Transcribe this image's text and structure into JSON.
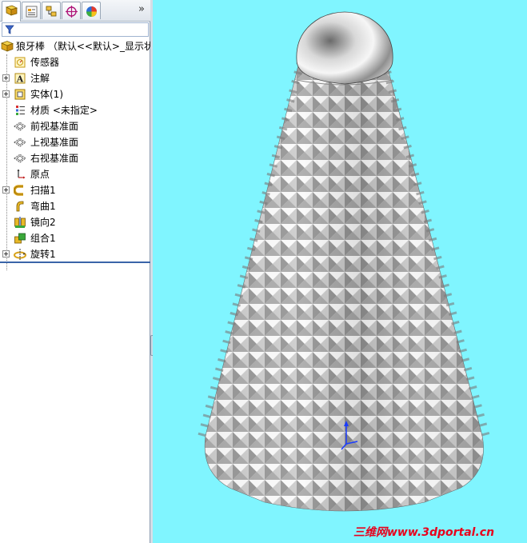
{
  "tabs": [
    {
      "id": "feature-manager",
      "icon": "feature-tree-icon",
      "active": true
    },
    {
      "id": "property-manager",
      "icon": "property-sheet-icon",
      "active": false
    },
    {
      "id": "configuration-manager",
      "icon": "configuration-icon",
      "active": false
    },
    {
      "id": "dim-xpert",
      "icon": "crosshair-icon",
      "active": false
    },
    {
      "id": "display-manager",
      "icon": "appearance-ball-icon",
      "active": false
    }
  ],
  "more_label": "»",
  "tree": {
    "root_label": "狼牙棒 （默认<<默认>_显示状",
    "items": [
      {
        "label": "传感器",
        "icon": "sensor-icon",
        "expandable": false
      },
      {
        "label": "注解",
        "icon": "annotation-icon",
        "expandable": true
      },
      {
        "label": "实体(1)",
        "icon": "solid-bodies-icon",
        "expandable": true
      },
      {
        "label": "材质 <未指定>",
        "icon": "material-icon",
        "expandable": false
      },
      {
        "label": "前视基准面",
        "icon": "plane-icon",
        "expandable": false
      },
      {
        "label": "上视基准面",
        "icon": "plane-icon",
        "expandable": false
      },
      {
        "label": "右视基准面",
        "icon": "plane-icon",
        "expandable": false
      },
      {
        "label": "原点",
        "icon": "origin-icon",
        "expandable": false
      },
      {
        "label": "扫描1",
        "icon": "sweep-icon",
        "expandable": true
      },
      {
        "label": "弯曲1",
        "icon": "flex-icon",
        "expandable": false
      },
      {
        "label": "镜向2",
        "icon": "mirror-icon",
        "expandable": false
      },
      {
        "label": "组合1",
        "icon": "combine-icon",
        "expandable": false
      },
      {
        "label": "旋转1",
        "icon": "revolve-icon",
        "expandable": true
      }
    ]
  },
  "viewport": {
    "background": "#80f5ff",
    "model_fill": "#b8b8b8",
    "cap_fill": "#cfcfcf",
    "triad_color": "#1a3cff",
    "watermark": "三维网www.3dportal.cn",
    "watermark_color": "#e8001c"
  }
}
